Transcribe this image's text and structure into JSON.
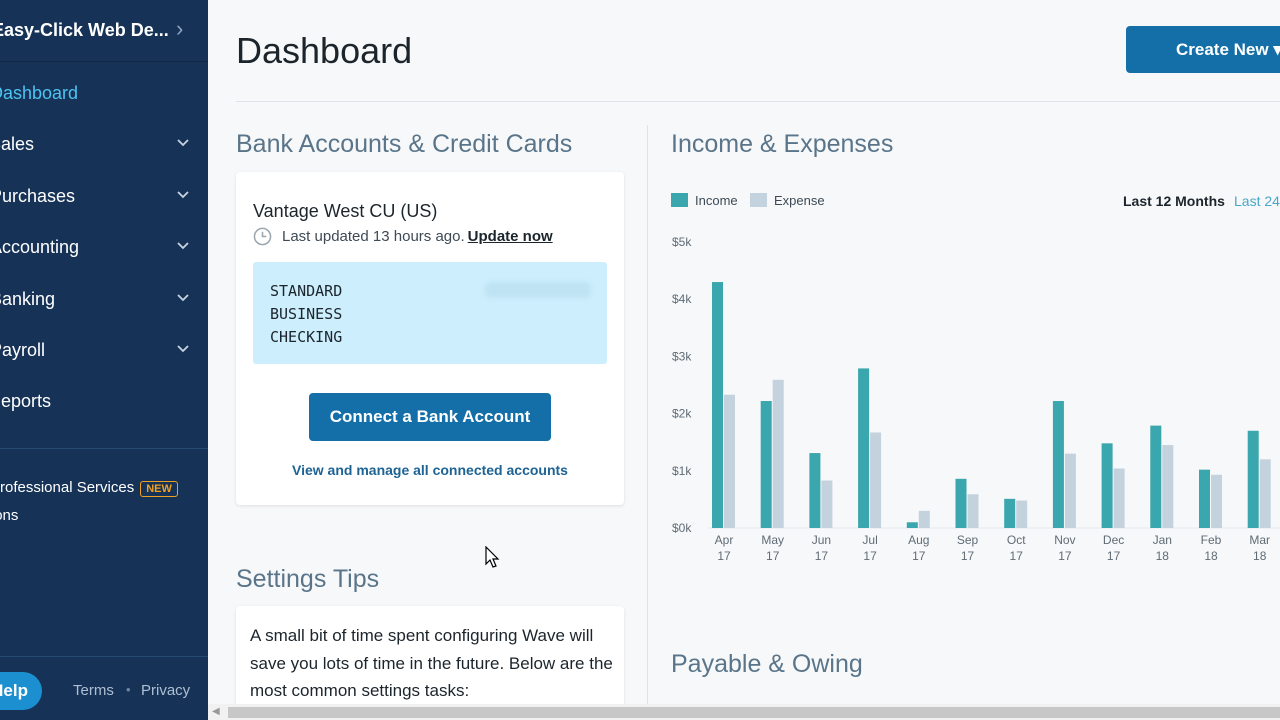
{
  "sidebar": {
    "business_name": "Easy-Click Web De...",
    "nav": [
      {
        "label": "Dashboard",
        "active": true,
        "has_children": false
      },
      {
        "label": "Sales",
        "active": false,
        "has_children": true
      },
      {
        "label": "Purchases",
        "active": false,
        "has_children": true
      },
      {
        "label": "Accounting",
        "active": false,
        "has_children": true
      },
      {
        "label": "Banking",
        "active": false,
        "has_children": true
      },
      {
        "label": "Payroll",
        "active": false,
        "has_children": true
      },
      {
        "label": "Reports",
        "active": false,
        "has_children": false
      }
    ],
    "extras": [
      {
        "label": "Professional Services",
        "badge": "NEW"
      },
      {
        "label": "Integrations"
      }
    ],
    "help_label": "Help",
    "terms_label": "Terms",
    "privacy_label": "Privacy"
  },
  "header": {
    "title": "Dashboard",
    "create_button": "Create New ▾"
  },
  "bank": {
    "section_title": "Bank Accounts & Credit Cards",
    "institution": "Vantage West CU (US)",
    "last_updated": "Last updated 13 hours ago.",
    "update_link": "Update now",
    "account_name": "STANDARD BUSINESS CHECKING",
    "connect_button": "Connect a Bank Account",
    "manage_link": "View and manage all connected accounts"
  },
  "tips": {
    "section_title": "Settings Tips",
    "text": "A small bit of time spent configuring Wave will save you lots of time in the future. Below are the most common settings tasks:"
  },
  "income_expenses": {
    "section_title": "Income & Expenses",
    "range_active": "Last 12 Months",
    "range_other": "Last 24"
  },
  "payable": {
    "section_title": "Payable & Owing"
  },
  "colors": {
    "income": "#3aa6ad",
    "expense": "#c3d2dc",
    "sidebar_bg": "#163357",
    "accent": "#146fa8"
  },
  "chart_data": {
    "type": "bar",
    "categories": [
      [
        "Apr",
        "17"
      ],
      [
        "May",
        "17"
      ],
      [
        "Jun",
        "17"
      ],
      [
        "Jul",
        "17"
      ],
      [
        "Aug",
        "17"
      ],
      [
        "Sep",
        "17"
      ],
      [
        "Oct",
        "17"
      ],
      [
        "Nov",
        "17"
      ],
      [
        "Dec",
        "17"
      ],
      [
        "Jan",
        "18"
      ],
      [
        "Feb",
        "18"
      ],
      [
        "Mar",
        "18"
      ]
    ],
    "series": [
      {
        "name": "Income",
        "values": [
          4300,
          2220,
          1310,
          2790,
          100,
          860,
          510,
          2220,
          1480,
          1790,
          1020,
          1700
        ]
      },
      {
        "name": "Expense",
        "values": [
          2330,
          2590,
          830,
          1670,
          300,
          590,
          480,
          1300,
          1040,
          1450,
          930,
          1200
        ]
      }
    ],
    "yticks": [
      "$0k",
      "$1k",
      "$2k",
      "$3k",
      "$4k",
      "$5k"
    ],
    "ylim": [
      0,
      5000
    ],
    "legend": "top-left",
    "grid": false
  }
}
